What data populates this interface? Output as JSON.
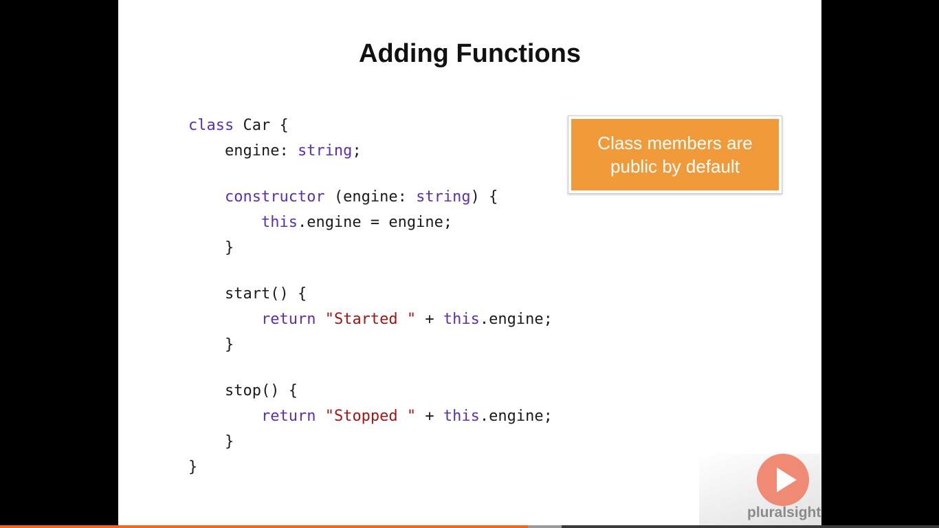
{
  "slide": {
    "title": "Adding Functions",
    "callout_text": "Class members are public by default",
    "code_lines": [
      [
        {
          "t": "class",
          "c": "kw"
        },
        {
          "t": " Car {",
          "c": "pl"
        }
      ],
      [
        {
          "t": "    engine: ",
          "c": "pl"
        },
        {
          "t": "string",
          "c": "kw"
        },
        {
          "t": ";",
          "c": "pl"
        }
      ],
      [],
      [
        {
          "t": "    ",
          "c": "pl"
        },
        {
          "t": "constructor",
          "c": "kw"
        },
        {
          "t": " (engine: ",
          "c": "pl"
        },
        {
          "t": "string",
          "c": "kw"
        },
        {
          "t": ") {",
          "c": "pl"
        }
      ],
      [
        {
          "t": "        ",
          "c": "pl"
        },
        {
          "t": "this",
          "c": "kw"
        },
        {
          "t": ".engine = engine;",
          "c": "pl"
        }
      ],
      [
        {
          "t": "    }",
          "c": "pl"
        }
      ],
      [],
      [
        {
          "t": "    start() {",
          "c": "pl"
        }
      ],
      [
        {
          "t": "        ",
          "c": "pl"
        },
        {
          "t": "return",
          "c": "kw"
        },
        {
          "t": " ",
          "c": "pl"
        },
        {
          "t": "\"Started \"",
          "c": "str"
        },
        {
          "t": " + ",
          "c": "pl"
        },
        {
          "t": "this",
          "c": "kw"
        },
        {
          "t": ".engine;",
          "c": "pl"
        }
      ],
      [
        {
          "t": "    }",
          "c": "pl"
        }
      ],
      [],
      [
        {
          "t": "    stop() {",
          "c": "pl"
        }
      ],
      [
        {
          "t": "        ",
          "c": "pl"
        },
        {
          "t": "return",
          "c": "kw"
        },
        {
          "t": " ",
          "c": "pl"
        },
        {
          "t": "\"Stopped \"",
          "c": "str"
        },
        {
          "t": " + ",
          "c": "pl"
        },
        {
          "t": "this",
          "c": "kw"
        },
        {
          "t": ".engine;",
          "c": "pl"
        }
      ],
      [
        {
          "t": "    }",
          "c": "pl"
        }
      ],
      [
        {
          "t": "}",
          "c": "pl"
        }
      ]
    ]
  },
  "watermark": {
    "brand": "pluralsight",
    "icon": "play-icon"
  },
  "player": {
    "progress_fraction": 0.562,
    "buffered_fraction": 0.598
  },
  "colors": {
    "keyword": "#5a2fb0",
    "string": "#a31515",
    "callout_bg": "#f09a3a",
    "progress": "#f26522"
  }
}
